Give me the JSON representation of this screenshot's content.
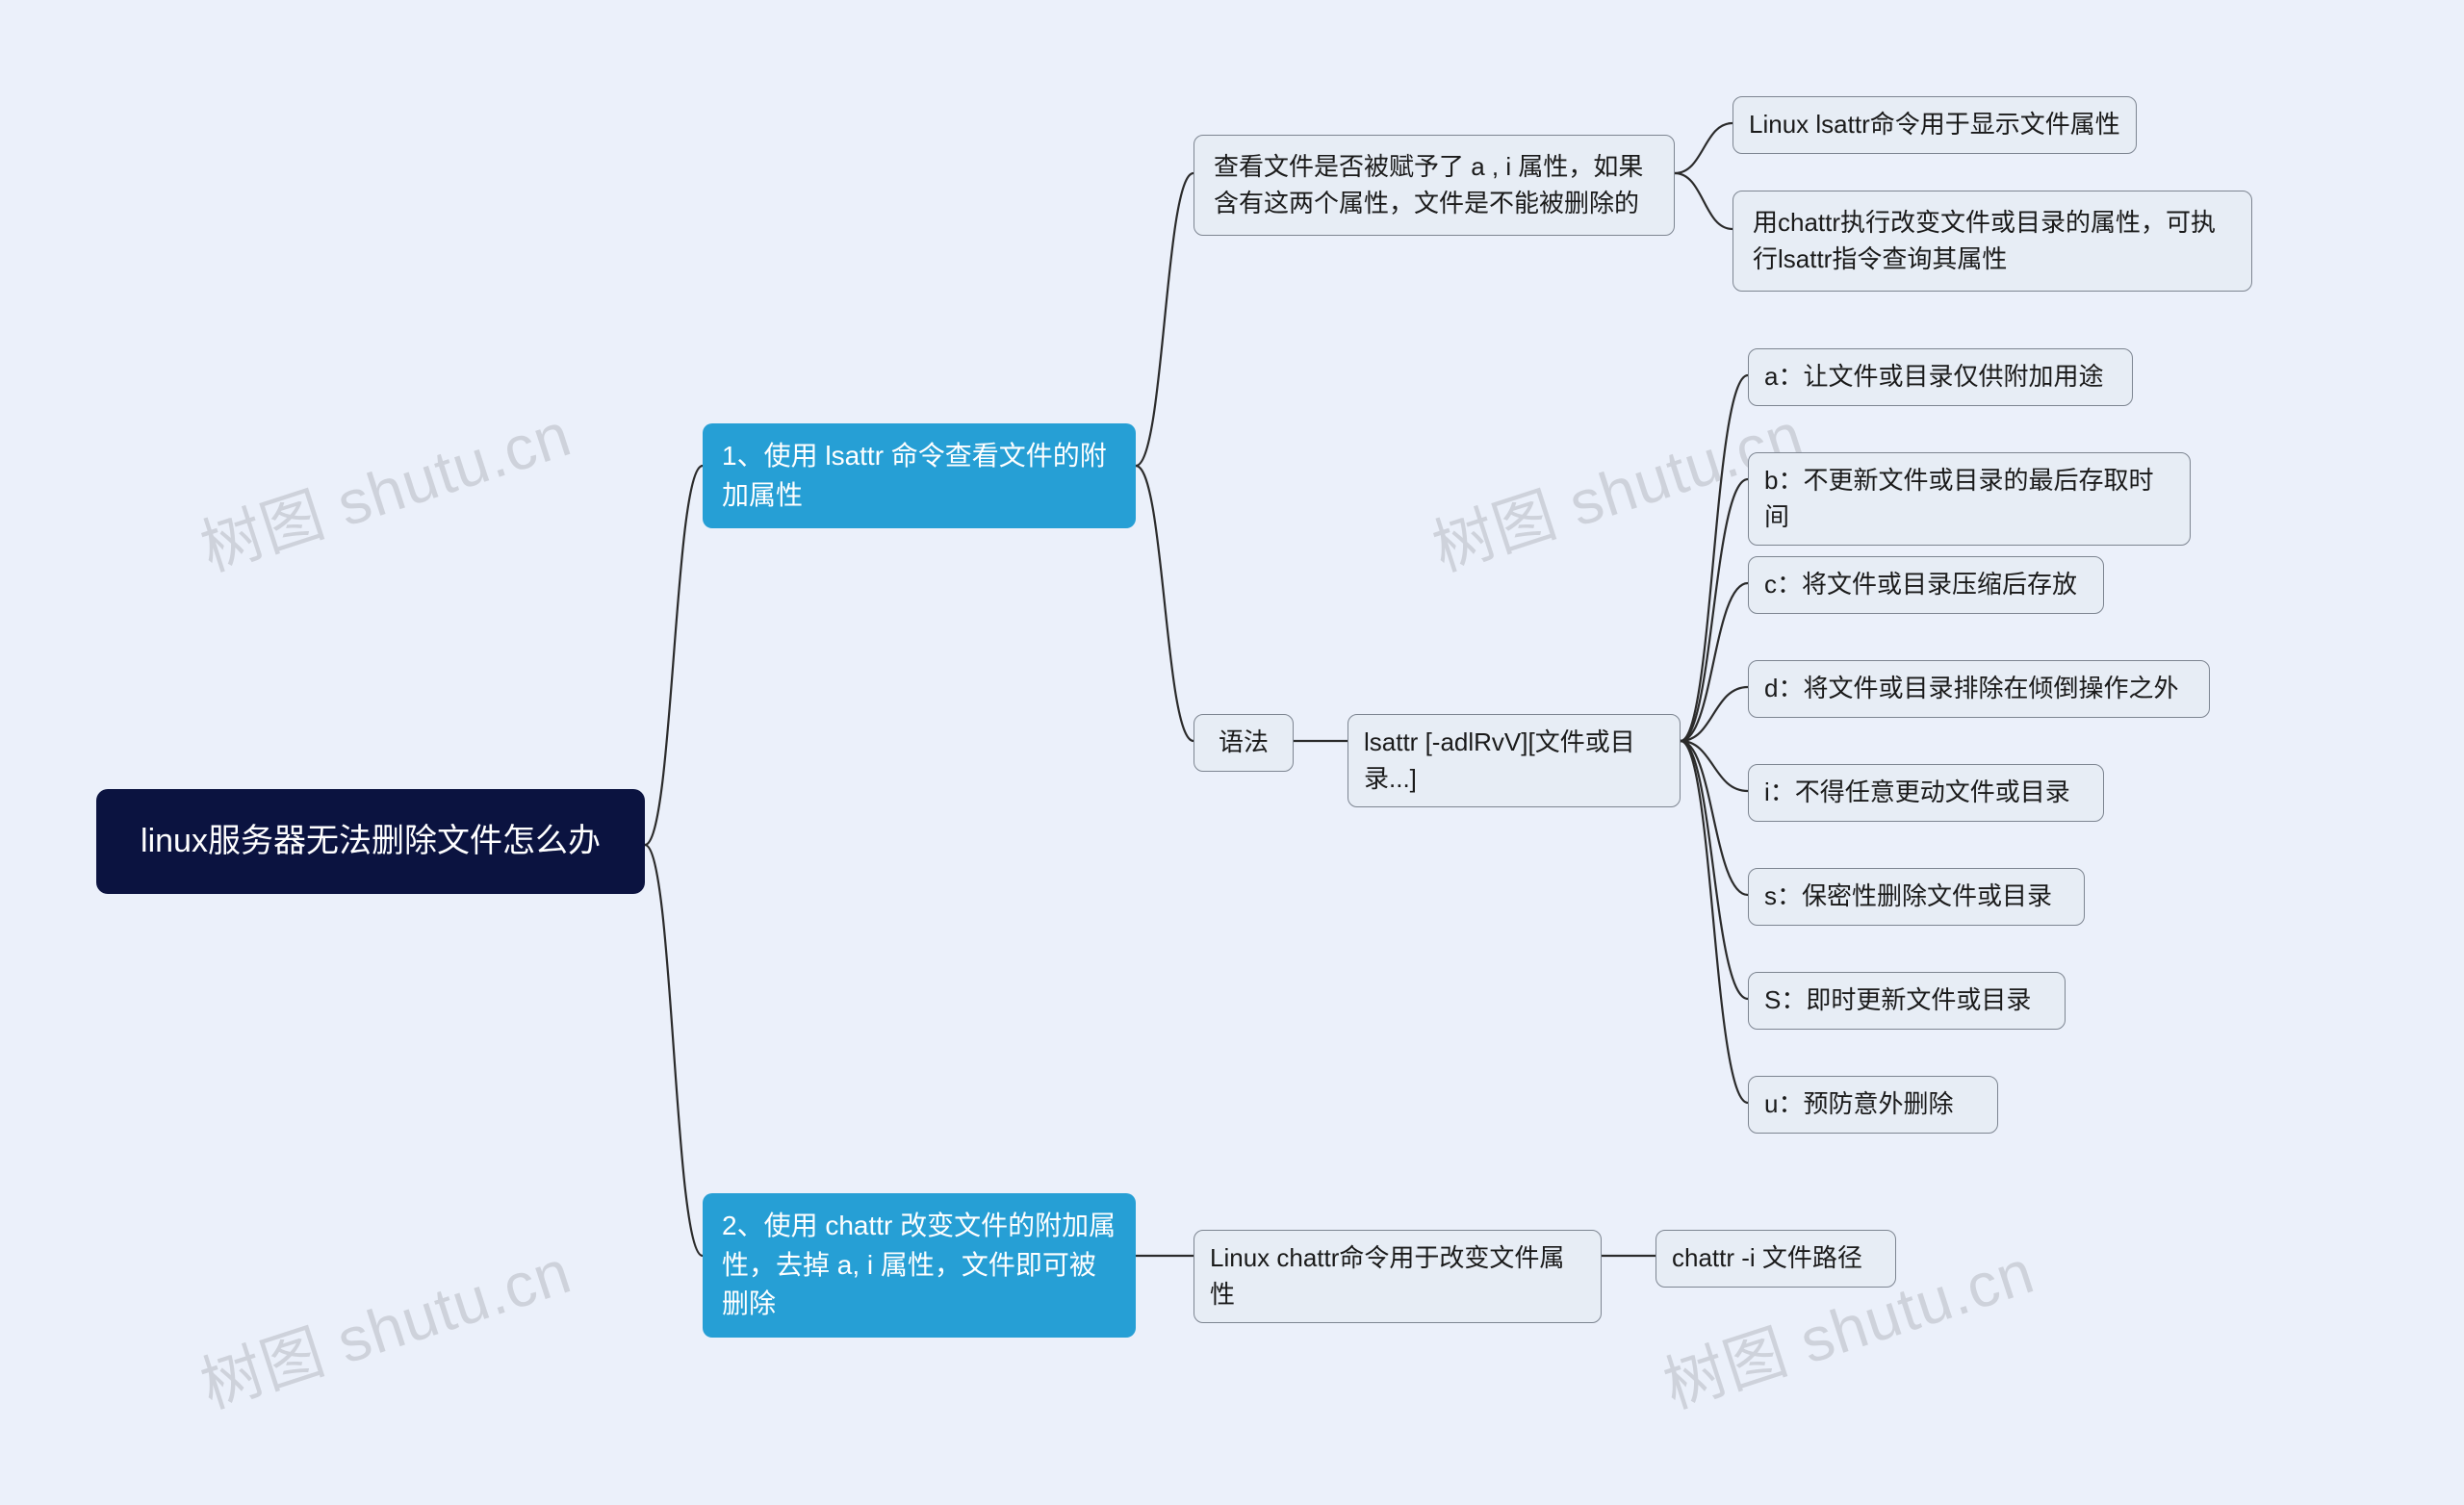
{
  "watermark": "树图 shutu.cn",
  "root": {
    "title": "linux服务器无法删除文件怎么办"
  },
  "nodes": {
    "main1": "1、使用 lsattr 命令查看文件的附加属性",
    "main2": "2、使用 chattr 改变文件的附加属性，去掉 a, i 属性，文件即可被删除",
    "check_ai": "查看文件是否被赋予了 a , i 属性，如果含有这两个属性，文件是不能被删除的",
    "lsattr_desc": "Linux lsattr命令用于显示文件属性",
    "chattr_change": "用chattr执行改变文件或目录的属性，可执行lsattr指令查询其属性",
    "syntax_label": "语法",
    "syntax_cmd": "lsattr [-adlRvV][文件或目录...]",
    "opt_a": "a：让文件或目录仅供附加用途",
    "opt_b": "b：不更新文件或目录的最后存取时间",
    "opt_c": "c：将文件或目录压缩后存放",
    "opt_d": "d：将文件或目录排除在倾倒操作之外",
    "opt_i": "i：不得任意更动文件或目录",
    "opt_s": "s：保密性删除文件或目录",
    "opt_S": "S：即时更新文件或目录",
    "opt_u": "u：预防意外删除",
    "chattr_desc": "Linux chattr命令用于改变文件属性",
    "chattr_cmd": "chattr -i 文件路径"
  }
}
